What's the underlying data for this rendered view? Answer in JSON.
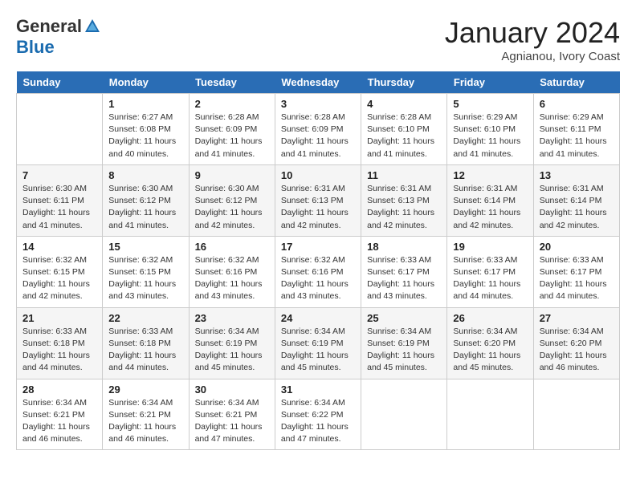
{
  "logo": {
    "general": "General",
    "blue": "Blue"
  },
  "header": {
    "title": "January 2024",
    "subtitle": "Agnianou, Ivory Coast"
  },
  "weekdays": [
    "Sunday",
    "Monday",
    "Tuesday",
    "Wednesday",
    "Thursday",
    "Friday",
    "Saturday"
  ],
  "weeks": [
    [
      {
        "day": "",
        "content": ""
      },
      {
        "day": "1",
        "sunrise": "Sunrise: 6:27 AM",
        "sunset": "Sunset: 6:08 PM",
        "daylight": "Daylight: 11 hours and 40 minutes."
      },
      {
        "day": "2",
        "sunrise": "Sunrise: 6:28 AM",
        "sunset": "Sunset: 6:09 PM",
        "daylight": "Daylight: 11 hours and 41 minutes."
      },
      {
        "day": "3",
        "sunrise": "Sunrise: 6:28 AM",
        "sunset": "Sunset: 6:09 PM",
        "daylight": "Daylight: 11 hours and 41 minutes."
      },
      {
        "day": "4",
        "sunrise": "Sunrise: 6:28 AM",
        "sunset": "Sunset: 6:10 PM",
        "daylight": "Daylight: 11 hours and 41 minutes."
      },
      {
        "day": "5",
        "sunrise": "Sunrise: 6:29 AM",
        "sunset": "Sunset: 6:10 PM",
        "daylight": "Daylight: 11 hours and 41 minutes."
      },
      {
        "day": "6",
        "sunrise": "Sunrise: 6:29 AM",
        "sunset": "Sunset: 6:11 PM",
        "daylight": "Daylight: 11 hours and 41 minutes."
      }
    ],
    [
      {
        "day": "7",
        "sunrise": "Sunrise: 6:30 AM",
        "sunset": "Sunset: 6:11 PM",
        "daylight": "Daylight: 11 hours and 41 minutes."
      },
      {
        "day": "8",
        "sunrise": "Sunrise: 6:30 AM",
        "sunset": "Sunset: 6:12 PM",
        "daylight": "Daylight: 11 hours and 41 minutes."
      },
      {
        "day": "9",
        "sunrise": "Sunrise: 6:30 AM",
        "sunset": "Sunset: 6:12 PM",
        "daylight": "Daylight: 11 hours and 42 minutes."
      },
      {
        "day": "10",
        "sunrise": "Sunrise: 6:31 AM",
        "sunset": "Sunset: 6:13 PM",
        "daylight": "Daylight: 11 hours and 42 minutes."
      },
      {
        "day": "11",
        "sunrise": "Sunrise: 6:31 AM",
        "sunset": "Sunset: 6:13 PM",
        "daylight": "Daylight: 11 hours and 42 minutes."
      },
      {
        "day": "12",
        "sunrise": "Sunrise: 6:31 AM",
        "sunset": "Sunset: 6:14 PM",
        "daylight": "Daylight: 11 hours and 42 minutes."
      },
      {
        "day": "13",
        "sunrise": "Sunrise: 6:31 AM",
        "sunset": "Sunset: 6:14 PM",
        "daylight": "Daylight: 11 hours and 42 minutes."
      }
    ],
    [
      {
        "day": "14",
        "sunrise": "Sunrise: 6:32 AM",
        "sunset": "Sunset: 6:15 PM",
        "daylight": "Daylight: 11 hours and 42 minutes."
      },
      {
        "day": "15",
        "sunrise": "Sunrise: 6:32 AM",
        "sunset": "Sunset: 6:15 PM",
        "daylight": "Daylight: 11 hours and 43 minutes."
      },
      {
        "day": "16",
        "sunrise": "Sunrise: 6:32 AM",
        "sunset": "Sunset: 6:16 PM",
        "daylight": "Daylight: 11 hours and 43 minutes."
      },
      {
        "day": "17",
        "sunrise": "Sunrise: 6:32 AM",
        "sunset": "Sunset: 6:16 PM",
        "daylight": "Daylight: 11 hours and 43 minutes."
      },
      {
        "day": "18",
        "sunrise": "Sunrise: 6:33 AM",
        "sunset": "Sunset: 6:17 PM",
        "daylight": "Daylight: 11 hours and 43 minutes."
      },
      {
        "day": "19",
        "sunrise": "Sunrise: 6:33 AM",
        "sunset": "Sunset: 6:17 PM",
        "daylight": "Daylight: 11 hours and 44 minutes."
      },
      {
        "day": "20",
        "sunrise": "Sunrise: 6:33 AM",
        "sunset": "Sunset: 6:17 PM",
        "daylight": "Daylight: 11 hours and 44 minutes."
      }
    ],
    [
      {
        "day": "21",
        "sunrise": "Sunrise: 6:33 AM",
        "sunset": "Sunset: 6:18 PM",
        "daylight": "Daylight: 11 hours and 44 minutes."
      },
      {
        "day": "22",
        "sunrise": "Sunrise: 6:33 AM",
        "sunset": "Sunset: 6:18 PM",
        "daylight": "Daylight: 11 hours and 44 minutes."
      },
      {
        "day": "23",
        "sunrise": "Sunrise: 6:34 AM",
        "sunset": "Sunset: 6:19 PM",
        "daylight": "Daylight: 11 hours and 45 minutes."
      },
      {
        "day": "24",
        "sunrise": "Sunrise: 6:34 AM",
        "sunset": "Sunset: 6:19 PM",
        "daylight": "Daylight: 11 hours and 45 minutes."
      },
      {
        "day": "25",
        "sunrise": "Sunrise: 6:34 AM",
        "sunset": "Sunset: 6:19 PM",
        "daylight": "Daylight: 11 hours and 45 minutes."
      },
      {
        "day": "26",
        "sunrise": "Sunrise: 6:34 AM",
        "sunset": "Sunset: 6:20 PM",
        "daylight": "Daylight: 11 hours and 45 minutes."
      },
      {
        "day": "27",
        "sunrise": "Sunrise: 6:34 AM",
        "sunset": "Sunset: 6:20 PM",
        "daylight": "Daylight: 11 hours and 46 minutes."
      }
    ],
    [
      {
        "day": "28",
        "sunrise": "Sunrise: 6:34 AM",
        "sunset": "Sunset: 6:21 PM",
        "daylight": "Daylight: 11 hours and 46 minutes."
      },
      {
        "day": "29",
        "sunrise": "Sunrise: 6:34 AM",
        "sunset": "Sunset: 6:21 PM",
        "daylight": "Daylight: 11 hours and 46 minutes."
      },
      {
        "day": "30",
        "sunrise": "Sunrise: 6:34 AM",
        "sunset": "Sunset: 6:21 PM",
        "daylight": "Daylight: 11 hours and 47 minutes."
      },
      {
        "day": "31",
        "sunrise": "Sunrise: 6:34 AM",
        "sunset": "Sunset: 6:22 PM",
        "daylight": "Daylight: 11 hours and 47 minutes."
      },
      {
        "day": "",
        "content": ""
      },
      {
        "day": "",
        "content": ""
      },
      {
        "day": "",
        "content": ""
      }
    ]
  ]
}
